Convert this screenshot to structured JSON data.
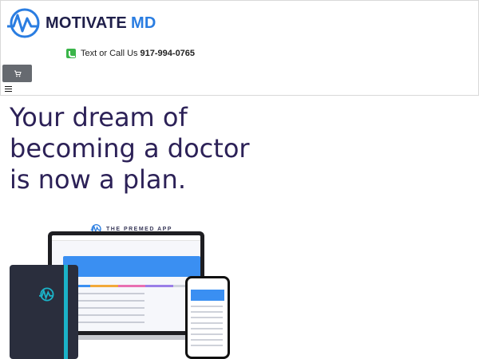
{
  "brand": {
    "name_primary": "MOTIVATE",
    "name_accent": "MD",
    "colors": {
      "navy": "#1f1f4a",
      "blue": "#2a7de1"
    }
  },
  "contact": {
    "label": "Text or Call Us",
    "phone": "917-994-0765",
    "icon": "phone-icon"
  },
  "header": {
    "cart_icon": "cart-icon",
    "menu_icon": "hamburger-menu-icon"
  },
  "hero": {
    "headline": "Your dream of becoming a doctor is now a plan."
  },
  "promo": {
    "app_label": "THE PREMED APP"
  }
}
